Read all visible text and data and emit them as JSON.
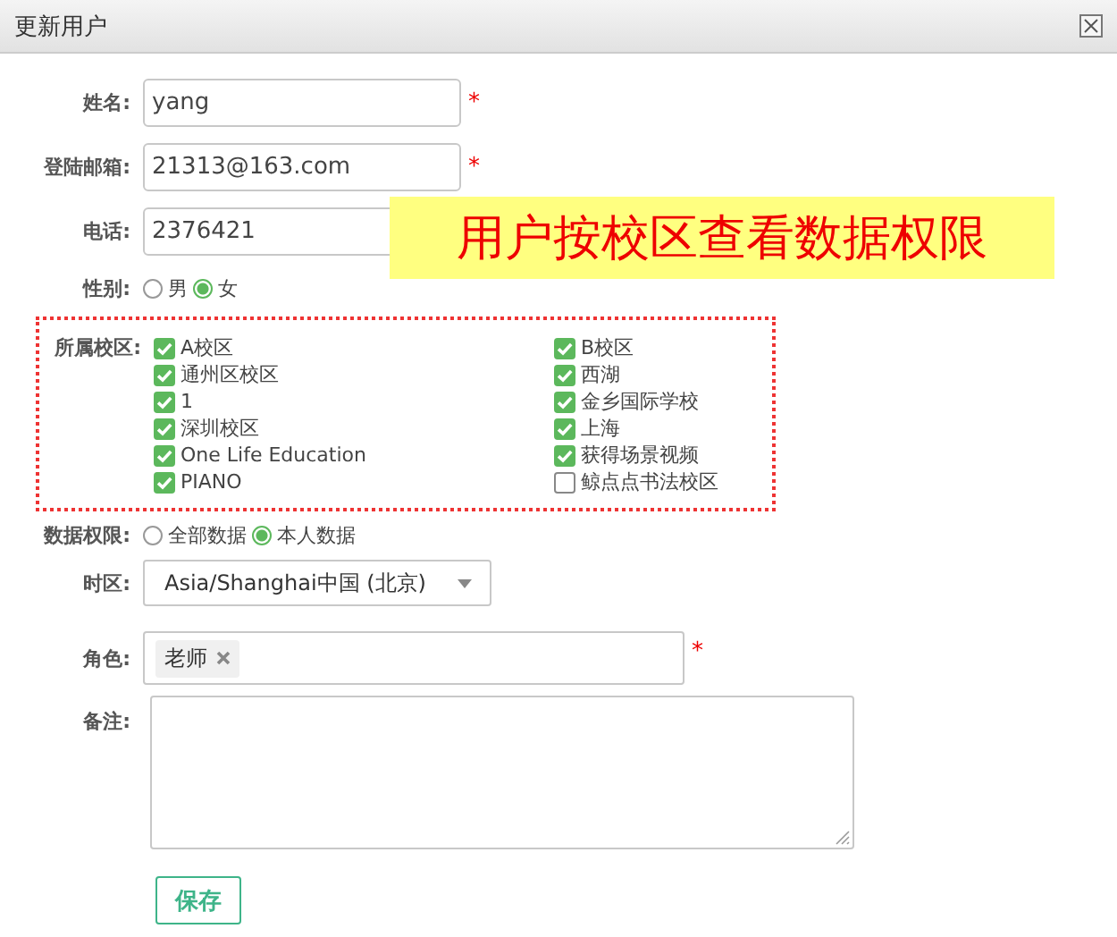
{
  "dialog": {
    "title": "更新用户"
  },
  "text_fields": [
    {
      "label": "姓名:",
      "value": "yang",
      "required_mark": "*"
    },
    {
      "label": "登陆邮箱:",
      "value": "21313@163.com",
      "required_mark": "*"
    },
    {
      "label": "电话:",
      "value": "2376421"
    }
  ],
  "annotation": "用户按校区查看数据权限",
  "gender": {
    "label": "性别:",
    "options": [
      {
        "label": "男",
        "selected": false
      },
      {
        "label": "女",
        "selected": true
      }
    ]
  },
  "campuses": {
    "label": "所属校区:",
    "columns": [
      [
        {
          "label": "A校区",
          "checked": true
        },
        {
          "label": "通州区校区",
          "checked": true
        },
        {
          "label": "1",
          "checked": true
        },
        {
          "label": "深圳校区",
          "checked": true
        },
        {
          "label": "One Life Education",
          "checked": true
        },
        {
          "label": "PIANO",
          "checked": true
        }
      ],
      [
        {
          "label": "B校区",
          "checked": true
        },
        {
          "label": "西湖",
          "checked": true
        },
        {
          "label": "金乡国际学校",
          "checked": true
        },
        {
          "label": "上海",
          "checked": true
        },
        {
          "label": "获得场景视频",
          "checked": true
        },
        {
          "label": "鲸点点书法校区",
          "checked": false
        }
      ]
    ]
  },
  "data_permission": {
    "label": "数据权限:",
    "options": [
      {
        "label": "全部数据",
        "selected": false
      },
      {
        "label": "本人数据",
        "selected": true
      }
    ]
  },
  "timezone": {
    "label": "时区:",
    "value": "Asia/Shanghai中国 (北京)"
  },
  "role": {
    "label": "角色:",
    "tags": [
      "老师"
    ],
    "required_mark": "*"
  },
  "remarks": {
    "label": "备注:"
  },
  "save_button": "保存"
}
